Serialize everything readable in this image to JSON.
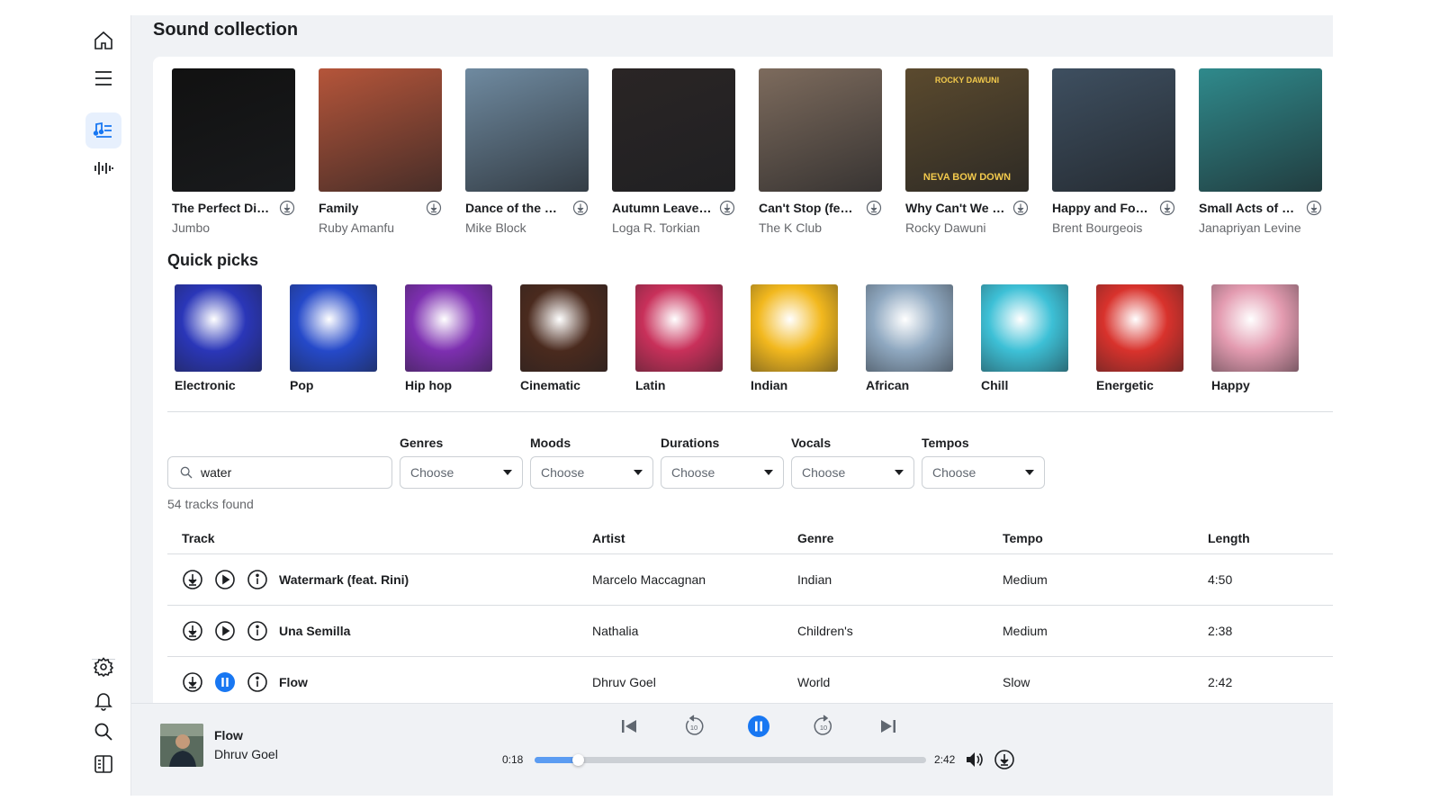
{
  "page_title": "Sound collection",
  "rail": {
    "items": [
      {
        "name": "home",
        "icon": "home-icon"
      },
      {
        "name": "menu",
        "icon": "menu-icon"
      },
      {
        "name": "music-library",
        "icon": "music-list-icon",
        "active": true
      },
      {
        "name": "waveform",
        "icon": "waveform-icon"
      }
    ],
    "bottom": [
      {
        "name": "settings",
        "icon": "gear-icon"
      },
      {
        "name": "notifications",
        "icon": "bell-icon"
      },
      {
        "name": "search",
        "icon": "search-icon"
      },
      {
        "name": "panel",
        "icon": "panel-icon"
      }
    ]
  },
  "albums": [
    {
      "title": "The Perfect Dis...",
      "artist": "Jumbo",
      "color": "#111111"
    },
    {
      "title": "Family",
      "artist": "Ruby Amanfu",
      "color": "#b5553a"
    },
    {
      "title": "Dance of the Re...",
      "artist": "Mike Block",
      "color": "#6f8aa0"
    },
    {
      "title": "Autumn Leaves...",
      "artist": "Loga R. Torkian",
      "color": "#2a2525"
    },
    {
      "title": "Can't Stop (feat...",
      "artist": "The K Club",
      "color": "#7d6b5d"
    },
    {
      "title": "Why Can't We B...",
      "artist": "Rocky Dawuni",
      "color": "#5b4a2e",
      "cover_top": "ROCKY DAWUNI",
      "cover_bottom": "NEVA BOW DOWN"
    },
    {
      "title": "Happy and Fore...",
      "artist": "Brent Bourgeois",
      "color": "#3e4f60"
    },
    {
      "title": "Small Acts of D...",
      "artist": "Janapriyan Levine",
      "color": "#2f8a8c"
    }
  ],
  "quick_picks": {
    "title": "Quick picks",
    "items": [
      {
        "label": "Electronic",
        "color": "#2a36b8"
      },
      {
        "label": "Pop",
        "color": "#2549c9"
      },
      {
        "label": "Hip hop",
        "color": "#7d2fb0"
      },
      {
        "label": "Cinematic",
        "color": "#4a2a1e"
      },
      {
        "label": "Latin",
        "color": "#c8305a"
      },
      {
        "label": "Indian",
        "color": "#f2b81e"
      },
      {
        "label": "African",
        "color": "#8fa8c0"
      },
      {
        "label": "Chill",
        "color": "#3dc0d6"
      },
      {
        "label": "Energetic",
        "color": "#d8322c"
      },
      {
        "label": "Happy",
        "color": "#e39bb0"
      }
    ]
  },
  "search": {
    "value": "water",
    "placeholder": "Search"
  },
  "filters": [
    {
      "label": "Genres",
      "value": "Choose"
    },
    {
      "label": "Moods",
      "value": "Choose"
    },
    {
      "label": "Durations",
      "value": "Choose"
    },
    {
      "label": "Vocals",
      "value": "Choose"
    },
    {
      "label": "Tempos",
      "value": "Choose"
    }
  ],
  "results_count": "54 tracks found",
  "table": {
    "headers": {
      "track": "Track",
      "artist": "Artist",
      "genre": "Genre",
      "tempo": "Tempo",
      "length": "Length"
    },
    "rows": [
      {
        "track": "Watermark (feat. Rini)",
        "artist": "Marcelo Maccagnan",
        "genre": "Indian",
        "tempo": "Medium",
        "length": "4:50",
        "playing": false
      },
      {
        "track": "Una Semilla",
        "artist": "Nathalia",
        "genre": "Children's",
        "tempo": "Medium",
        "length": "2:38",
        "playing": false
      },
      {
        "track": "Flow",
        "artist": "Dhruv Goel",
        "genre": "World",
        "tempo": "Slow",
        "length": "2:42",
        "playing": true
      }
    ]
  },
  "player": {
    "title": "Flow",
    "artist": "Dhruv Goel",
    "current_time": "0:18",
    "total_time": "2:42",
    "progress_fraction": 0.111,
    "skip_seconds": "10",
    "accent": "#1877f2"
  }
}
